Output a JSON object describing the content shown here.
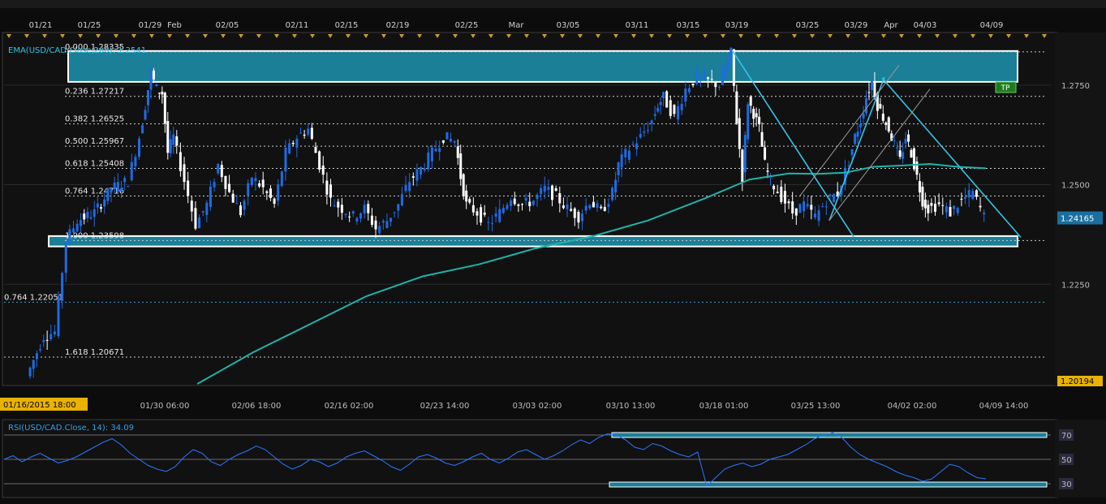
{
  "colors": {
    "background": "#111111",
    "panel": "#151515",
    "grid": "#2a2a2a",
    "candle_up": "#1e6be6",
    "candle_down": "#ffffff",
    "ema": "#20b2aa",
    "zone_fill": "#1a7f97",
    "trendline": "#35c4e6",
    "channel": "#9a9a9a",
    "rsi_line": "#2a78ff",
    "tp_fill": "#1f7a1f",
    "timestamp_fill": "#e9b200"
  },
  "top_date_labels": [
    "01/21",
    "01/25",
    "01/29",
    "Feb",
    "02/05",
    "02/11",
    "02/15",
    "02/19",
    "02/25",
    "Mar",
    "03/05",
    "03/11",
    "03/15",
    "03/19",
    "03/25",
    "03/29",
    "Apr",
    "04/03",
    "04/09"
  ],
  "bottom_time_labels": [
    "01/30 06:00",
    "02/06 18:00",
    "02/16 02:00",
    "02/23 14:00",
    "03/03 02:00",
    "03/10 13:00",
    "03/18 01:00",
    "03/25 13:00",
    "04/02 02:00",
    "04/09 14:00"
  ],
  "start_timestamp": "01/16/2015 18:00",
  "ema_label": "EMA(USD/CAD.Close,200): 1.2541",
  "rsi_label": "RSI(USD/CAD.Close, 14): 34.09",
  "price_axis": {
    "ticks": [
      "1.2750",
      "1.2500",
      "1.2250"
    ],
    "current": "1.24165",
    "low": "1.20194"
  },
  "rsi_axis": {
    "ticks": [
      "70",
      "50",
      "30"
    ]
  },
  "tp_label": "TP",
  "chart_data": {
    "type": "line",
    "title": "",
    "symbol": "USD/CAD",
    "y_range": [
      1.2,
      1.288
    ],
    "fib_levels": [
      {
        "label": "0.000 1.28335",
        "value": 1.28335
      },
      {
        "label": "0.236 1.27217",
        "value": 1.27217
      },
      {
        "label": "0.382 1.26525",
        "value": 1.26525
      },
      {
        "label": "0.500 1.25967",
        "value": 1.25967
      },
      {
        "label": "0.618 1.25408",
        "value": 1.25408
      },
      {
        "label": "0.764 1.24716",
        "value": 1.24716
      },
      {
        "label": "1.000 1.23598",
        "value": 1.23598
      },
      {
        "label": "0.764 1.22051",
        "value": 1.22051
      },
      {
        "label": "1.618 1.20671",
        "value": 1.20671
      }
    ],
    "close_path": [
      [
        0,
        1.2019
      ],
      [
        3,
        1.212
      ],
      [
        5,
        1.213
      ],
      [
        7,
        1.236
      ],
      [
        9,
        1.241
      ],
      [
        12,
        1.243
      ],
      [
        15,
        1.249
      ],
      [
        18,
        1.251
      ],
      [
        20,
        1.262
      ],
      [
        21,
        1.27
      ],
      [
        22,
        1.278
      ],
      [
        23,
        1.274
      ],
      [
        24,
        1.273
      ],
      [
        25,
        1.258
      ],
      [
        26,
        1.262
      ],
      [
        28,
        1.251
      ],
      [
        30,
        1.24
      ],
      [
        32,
        1.245
      ],
      [
        34,
        1.255
      ],
      [
        36,
        1.248
      ],
      [
        38,
        1.243
      ],
      [
        40,
        1.252
      ],
      [
        42,
        1.249
      ],
      [
        44,
        1.245
      ],
      [
        46,
        1.258
      ],
      [
        48,
        1.262
      ],
      [
        50,
        1.264
      ],
      [
        52,
        1.255
      ],
      [
        54,
        1.246
      ],
      [
        56,
        1.244
      ],
      [
        58,
        1.242
      ],
      [
        60,
        1.244
      ],
      [
        62,
        1.239
      ],
      [
        64,
        1.241
      ],
      [
        66,
        1.245
      ],
      [
        68,
        1.251
      ],
      [
        70,
        1.254
      ],
      [
        72,
        1.258
      ],
      [
        74,
        1.262
      ],
      [
        76,
        1.261
      ],
      [
        77,
        1.252
      ],
      [
        78,
        1.245
      ],
      [
        80,
        1.243
      ],
      [
        82,
        1.24
      ],
      [
        84,
        1.243
      ],
      [
        86,
        1.247
      ],
      [
        88,
        1.245
      ],
      [
        90,
        1.246
      ],
      [
        92,
        1.249
      ],
      [
        94,
        1.247
      ],
      [
        96,
        1.244
      ],
      [
        98,
        1.242
      ],
      [
        100,
        1.246
      ],
      [
        102,
        1.243
      ],
      [
        104,
        1.248
      ],
      [
        105,
        1.255
      ],
      [
        107,
        1.259
      ],
      [
        109,
        1.262
      ],
      [
        111,
        1.266
      ],
      [
        112,
        1.27
      ],
      [
        113,
        1.272
      ],
      [
        115,
        1.267
      ],
      [
        117,
        1.274
      ],
      [
        119,
        1.277
      ],
      [
        121,
        1.276
      ],
      [
        123,
        1.275
      ],
      [
        124,
        1.279
      ],
      [
        125,
        1.283
      ],
      [
        126,
        1.266
      ],
      [
        127,
        1.252
      ],
      [
        128,
        1.271
      ],
      [
        129,
        1.268
      ],
      [
        130,
        1.264
      ],
      [
        131,
        1.255
      ],
      [
        132,
        1.251
      ],
      [
        134,
        1.247
      ],
      [
        136,
        1.243
      ],
      [
        138,
        1.245
      ],
      [
        140,
        1.242
      ],
      [
        142,
        1.246
      ],
      [
        144,
        1.248
      ],
      [
        146,
        1.256
      ],
      [
        147,
        1.262
      ],
      [
        148,
        1.266
      ],
      [
        149,
        1.272
      ],
      [
        150,
        1.276
      ],
      [
        151,
        1.27
      ],
      [
        152,
        1.267
      ],
      [
        153,
        1.264
      ],
      [
        154,
        1.26
      ],
      [
        155,
        1.256
      ],
      [
        156,
        1.262
      ],
      [
        157,
        1.258
      ],
      [
        158,
        1.252
      ],
      [
        159,
        1.246
      ],
      [
        160,
        1.244
      ],
      [
        162,
        1.245
      ],
      [
        164,
        1.243
      ],
      [
        166,
        1.246
      ],
      [
        168,
        1.248
      ],
      [
        170,
        1.242
      ]
    ],
    "ema_200_path": [
      [
        30,
        1.2
      ],
      [
        40,
        1.208
      ],
      [
        50,
        1.215
      ],
      [
        60,
        1.222
      ],
      [
        70,
        1.227
      ],
      [
        80,
        1.23
      ],
      [
        90,
        1.234
      ],
      [
        100,
        1.237
      ],
      [
        110,
        1.241
      ],
      [
        120,
        1.2465
      ],
      [
        128,
        1.2513
      ],
      [
        135,
        1.2528
      ],
      [
        140,
        1.2527
      ],
      [
        145,
        1.253
      ],
      [
        150,
        1.2545
      ],
      [
        155,
        1.2548
      ],
      [
        160,
        1.2552
      ],
      [
        165,
        1.2545
      ],
      [
        170,
        1.2541
      ]
    ],
    "rsi": [
      50,
      53,
      48,
      52,
      55,
      51,
      47,
      49,
      52,
      56,
      60,
      64,
      67,
      62,
      55,
      50,
      45,
      42,
      40,
      44,
      52,
      58,
      55,
      48,
      45,
      50,
      54,
      57,
      61,
      58,
      52,
      46,
      42,
      45,
      50,
      48,
      44,
      47,
      52,
      55,
      57,
      53,
      49,
      44,
      41,
      46,
      52,
      54,
      51,
      47,
      45,
      48,
      52,
      55,
      50,
      47,
      51,
      56,
      58,
      54,
      50,
      53,
      57,
      62,
      66,
      63,
      68,
      71,
      70,
      66,
      60,
      58,
      63,
      61,
      57,
      54,
      52,
      56,
      28,
      35,
      42,
      45,
      47,
      44,
      46,
      50,
      52,
      54,
      58,
      62,
      67,
      70,
      72,
      68,
      60,
      54,
      50,
      47,
      44,
      40,
      37,
      35,
      32,
      34,
      40,
      46,
      44,
      39,
      35,
      34
    ],
    "rsi_range": [
      20,
      80
    ],
    "rsi_levels": [
      70,
      50,
      30
    ]
  }
}
